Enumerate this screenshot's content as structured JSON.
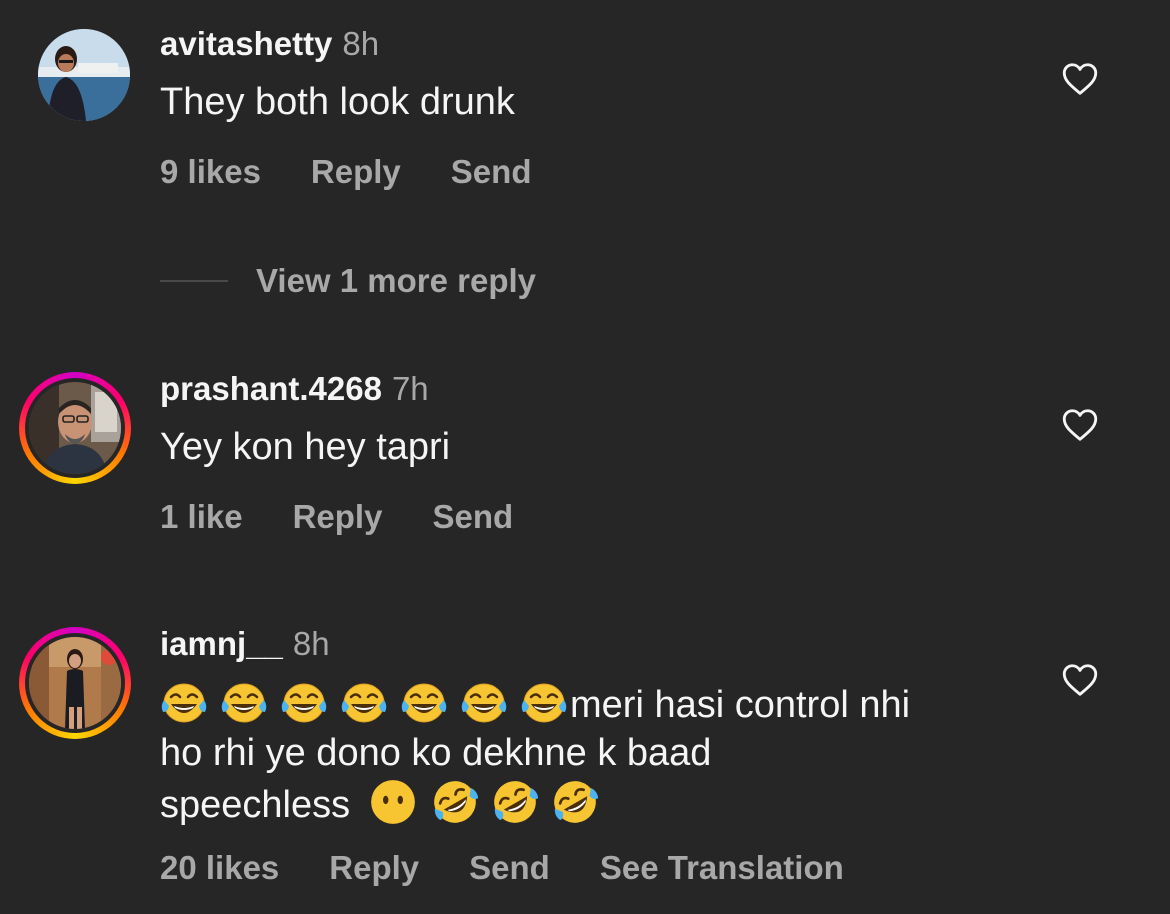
{
  "comments": [
    {
      "username": "avitashetty",
      "time": "8h",
      "text": "They both look drunk",
      "likes": "9 likes",
      "reply": "Reply",
      "send": "Send",
      "view_replies": "View 1 more reply"
    },
    {
      "username": "prashant.4268",
      "time": "7h",
      "text": "Yey kon hey tapri",
      "likes": "1 like",
      "reply": "Reply",
      "send": "Send"
    },
    {
      "username": "iamnj__",
      "time": "8h",
      "text_line1": "meri hasi control nhi",
      "text_line2": "ho rhi ye dono ko dekhne k baad",
      "text_line3": "speechless",
      "emojis_leading": [
        "tears-of-joy",
        "tears-of-joy",
        "tears-of-joy",
        "tears-of-joy",
        "tears-of-joy",
        "tears-of-joy",
        "tears-of-joy"
      ],
      "emojis_trailing": [
        "face-without-mouth",
        "rolling-on-floor-laughing",
        "rolling-on-floor-laughing",
        "rolling-on-floor-laughing"
      ],
      "likes": "20 likes",
      "reply": "Reply",
      "send": "Send",
      "translate": "See Translation"
    }
  ],
  "icons": {
    "like": "heart-outline-icon"
  },
  "colors": {
    "background": "#262626",
    "primary_text": "#f5f5f5",
    "secondary_text": "#a8a8a8",
    "story_ring": "#ff0069"
  }
}
